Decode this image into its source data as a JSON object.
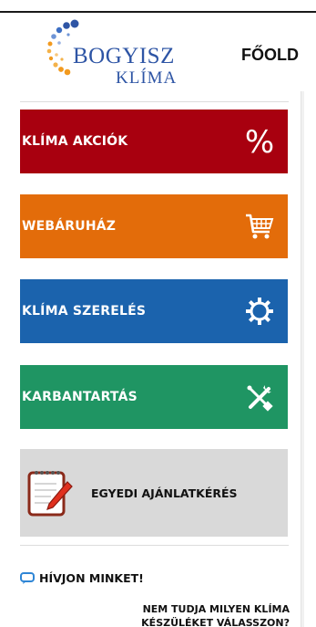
{
  "brand": {
    "name_line1": "BOGYISZ",
    "name_line2": "KLÍMA"
  },
  "nav": {
    "home_label": "FŐOLD"
  },
  "menu": [
    {
      "label": "KLÍMA AKCIÓK",
      "icon": "percent-icon",
      "color": "#a8000f"
    },
    {
      "label": "WEBÁRUHÁZ",
      "icon": "shopping-cart-icon",
      "color": "#e36c0a"
    },
    {
      "label": "KLÍMA SZERELÉS",
      "icon": "gear-icon",
      "color": "#1b63ad"
    },
    {
      "label": "KARBANTARTÁS",
      "icon": "tools-icon",
      "color": "#1f9563"
    }
  ],
  "quote": {
    "label": "EGYEDI AJÁNLATKÉRÉS",
    "icon": "notepad-pen-icon",
    "color": "#d9d9d9"
  },
  "contact": {
    "call_label": "HÍVJON MINKET!",
    "call_icon": "chat-bubble-icon",
    "question_line1": "NEM TUDJA MILYEN KLÍMA",
    "question_line2": "KÉSZÜLÉKET VÁLASSZON?"
  },
  "colors": {
    "brand_blue": "#2e55a5",
    "logo_orange": "#f29a1f"
  }
}
